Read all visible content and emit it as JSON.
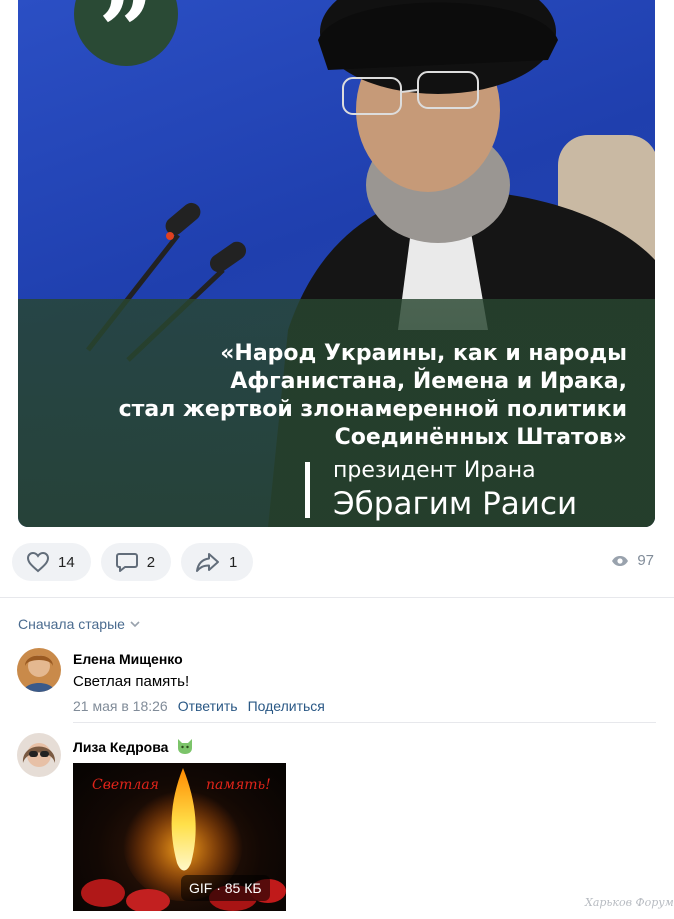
{
  "post": {
    "quote_mark": "”",
    "quote_lines": [
      "«Народ Украины, как и народы",
      "Афганистана, Йемена и Ирака,",
      "стал жертвой злонамеренной политики",
      "Соединённых Штатов»"
    ],
    "author_role": "президент Ирана",
    "author_name": "Эбрагим Раиси"
  },
  "actions": {
    "likes": "14",
    "comments": "2",
    "shares": "1",
    "views": "97"
  },
  "comments_sort": "Сначала старые",
  "comments": [
    {
      "author": "Елена Мищенко",
      "text": "Светлая память!",
      "date": "21 мая в 18:26",
      "reply": "Ответить",
      "share": "Поделиться"
    },
    {
      "author": "Лиза Кедрова",
      "gif_text_left": "Светлая",
      "gif_text_right": "память!",
      "gif_badge": "GIF · 85 КБ"
    }
  ],
  "watermark": "Харьков Форум",
  "colors": {
    "link": "#2a5885",
    "muted": "#818c99",
    "button_bg": "#f0f2f5",
    "panel_green": "#2a4a35",
    "bg_blue": "#2b4fc4"
  },
  "icons": [
    "quote-icon",
    "heart-icon",
    "comment-icon",
    "share-icon",
    "eye-icon",
    "chevron-down-icon",
    "cat-emoji-icon"
  ]
}
